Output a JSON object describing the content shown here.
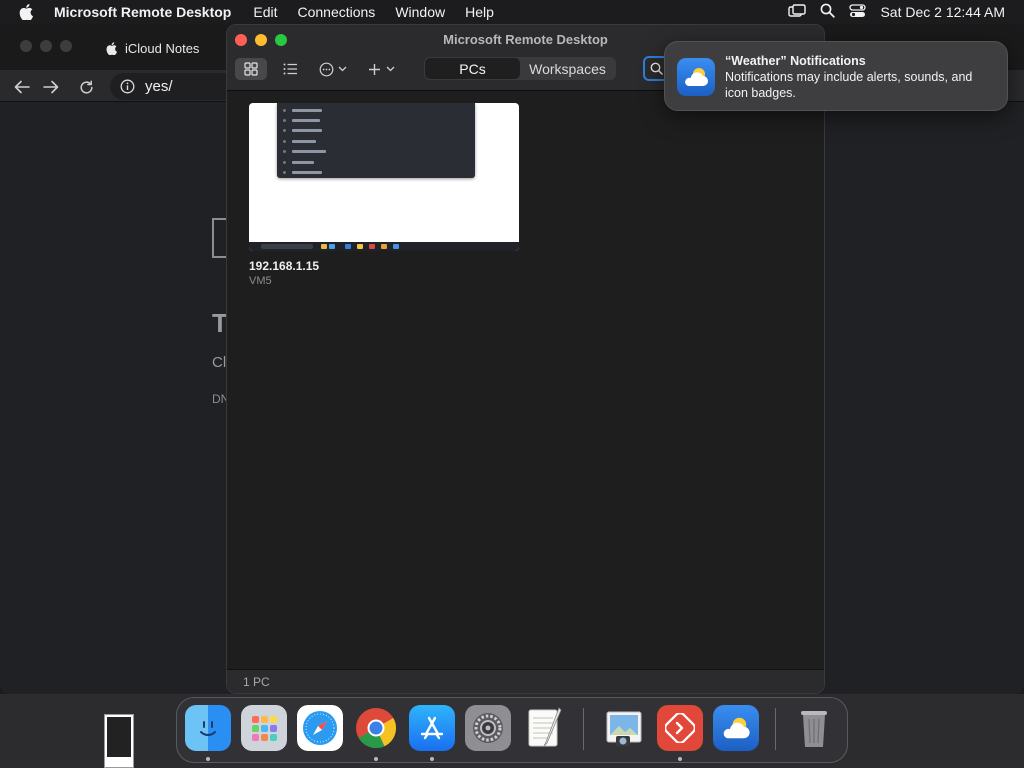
{
  "menubar": {
    "app_name": "Microsoft Remote Desktop",
    "items": [
      "Edit",
      "Connections",
      "Window",
      "Help"
    ],
    "clock": "Sat Dec 2  12:44 AM"
  },
  "browser": {
    "tab_title": "iCloud Notes",
    "address": "yes/",
    "page_text_t": "T",
    "page_text_c": "Cl",
    "page_text_d": "DN"
  },
  "rdp": {
    "window_title": "Microsoft Remote Desktop",
    "tabs": [
      "PCs",
      "Workspaces"
    ],
    "active_tab": "PCs",
    "pc": {
      "name": "192.168.1.15",
      "sub": "VM5"
    },
    "status": "1 PC"
  },
  "notification": {
    "title": "“Weather” Notifications",
    "body": "Notifications may include alerts, sounds, and icon badges."
  },
  "dock": {
    "apps": [
      "finder-icon",
      "launchpad-icon",
      "safari-icon",
      "chrome-icon",
      "app-store-icon",
      "system-settings-icon",
      "textedit-icon",
      "preview-icon",
      "remote-desktop-icon",
      "weather-icon",
      "trash-icon"
    ]
  }
}
